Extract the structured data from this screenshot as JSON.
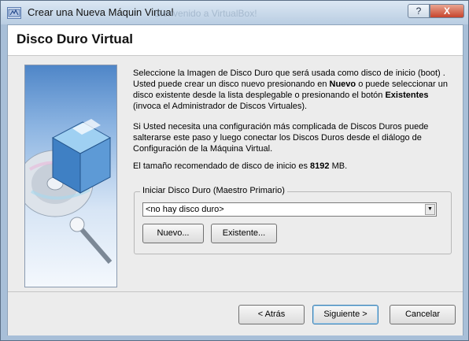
{
  "window": {
    "title": "Crear una Nueva Máquin Virtual",
    "background_ghost_title": "Bienvenido a VirtualBox!",
    "help_glyph": "?",
    "close_glyph": "X"
  },
  "header": {
    "title": "Disco Duro Virtual"
  },
  "description": {
    "p1_a": "Seleccione la Imagen de Disco Duro que será usada como disco de inicio (boot) . Usted puede crear un disco nuevo presionando en ",
    "p1_b": "Nuevo",
    "p1_c": " o puede seleccionar un disco existente desde la lista desplegable o presionando el botón ",
    "p1_d": "Existentes",
    "p1_e": " (invoca el Administrador de Discos Virtuales).",
    "p2": "Si Usted necesita una configuración más complicada de Discos Duros puede salterarse este paso y luego conectar los Discos Duros desde el diálogo de Configuración de la Máquina Virtual.",
    "p3_a": "El tamaño recomendado de disco de inicio es ",
    "p3_b": "8192",
    "p3_c": " MB."
  },
  "boot_disk": {
    "group_label": "Iniciar Disco Duro (Maestro Primario)",
    "selected": "<no hay disco duro>",
    "new_button": "Nuevo...",
    "existing_button": "Existente..."
  },
  "footer": {
    "back": "< Atrás",
    "next": "Siguiente >",
    "cancel": "Cancelar"
  },
  "colors": {
    "titlebar": "#c5d6ea",
    "panel": "#ececec",
    "image_blue": "#4f86c8",
    "close_red": "#c7442c"
  },
  "icons": {
    "app": "virtualbox-icon",
    "illustration": "virtualbox-disc-illustration"
  }
}
